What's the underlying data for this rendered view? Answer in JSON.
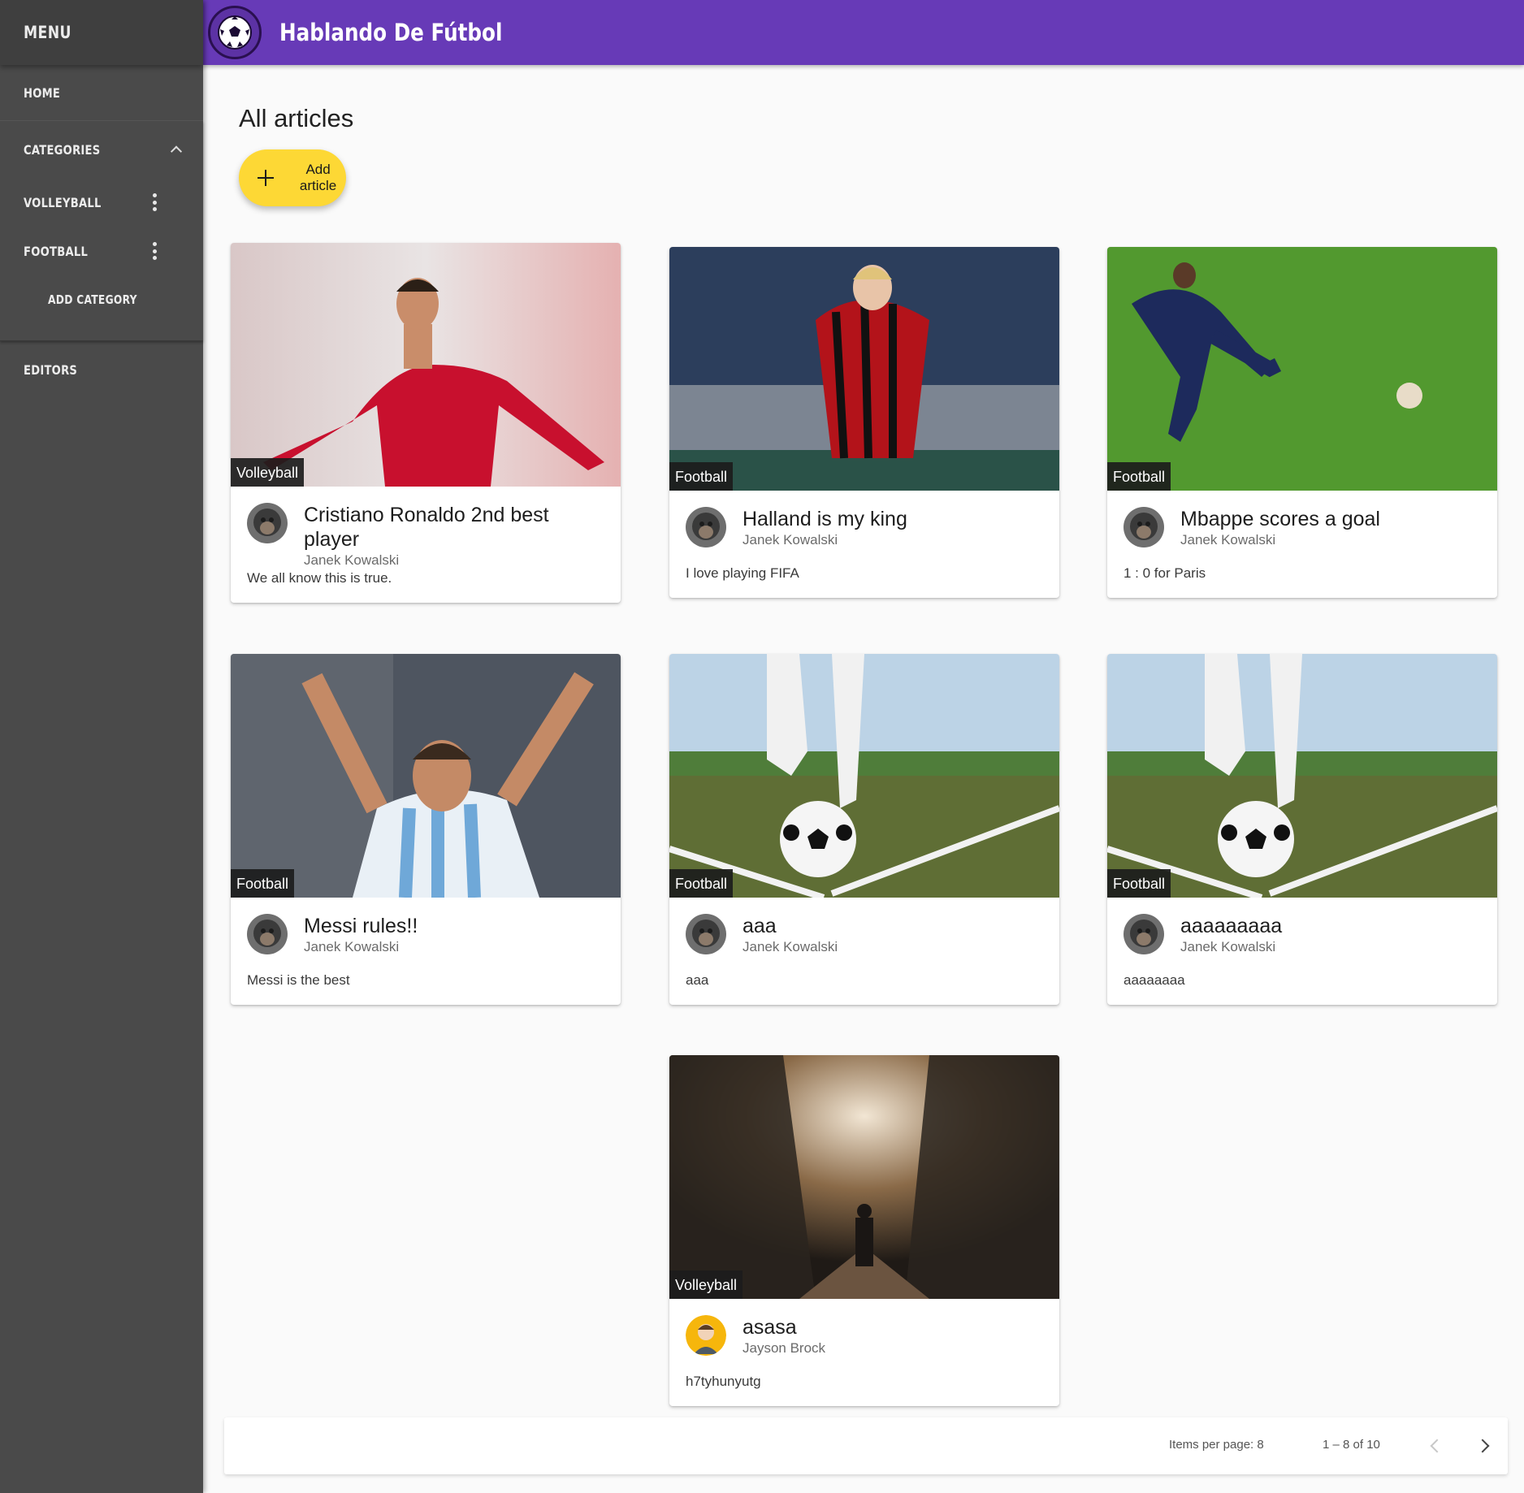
{
  "sidebar": {
    "title": "MENU",
    "home": "HOME",
    "categories": "CATEGORIES",
    "items": [
      "VOLLEYBALL",
      "FOOTBALL"
    ],
    "add_category": "ADD CATEGORY",
    "editors": "EDITORS"
  },
  "toolbar": {
    "title": "Hablando De Fútbol"
  },
  "main": {
    "heading": "All articles",
    "add_button": "Add article",
    "articles": [
      {
        "category": "Volleyball",
        "title": "Cristiano Ronaldo 2nd best player",
        "author": "Janek Kowalski",
        "body": "We all know this is true."
      },
      {
        "category": "Football",
        "title": "Halland is my king",
        "author": "Janek Kowalski",
        "body": "I love playing FIFA"
      },
      {
        "category": "Football",
        "title": "Mbappe scores a goal",
        "author": "Janek Kowalski",
        "body": "1 : 0 for Paris"
      },
      {
        "category": "Football",
        "title": "Messi rules!!",
        "author": "Janek Kowalski",
        "body": "Messi is the best"
      },
      {
        "category": "Football",
        "title": "aaa",
        "author": "Janek Kowalski",
        "body": "aaa"
      },
      {
        "category": "Football",
        "title": "aaaaaaaaa",
        "author": "Janek Kowalski",
        "body": "aaaaaaaa"
      },
      {
        "category": "Volleyball",
        "title": "asasa",
        "author": "Jayson Brock",
        "body": "h7tyhunyutg"
      }
    ]
  },
  "paginator": {
    "items_per_page": "Items per page: 8",
    "range": "1 – 8 of 10"
  },
  "colors": {
    "toolbar": "#673ab7",
    "sidebar": "#4a4a4a",
    "fab": "#fdd835"
  }
}
